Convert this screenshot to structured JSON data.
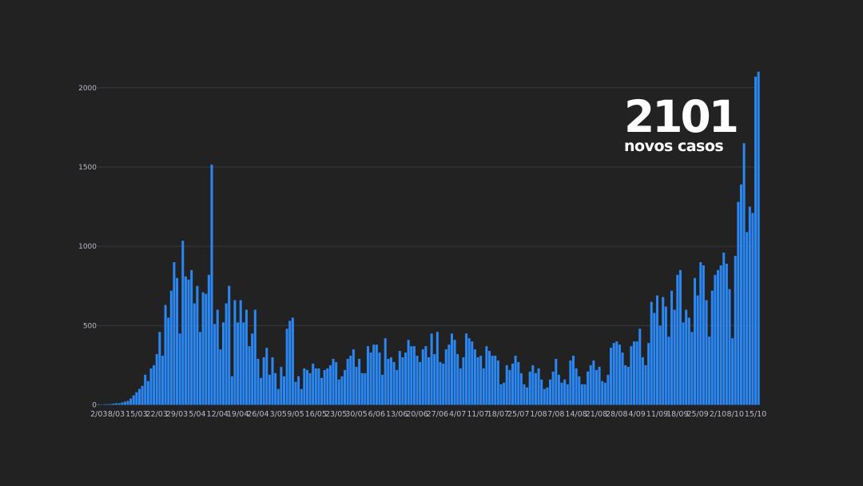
{
  "callout": {
    "number": "2101",
    "label": "novos casos"
  },
  "colors": {
    "background": "#222223",
    "bar": "#2b87f2",
    "grid": "#3a3a3c",
    "tick_label": "#b9bccb"
  },
  "chart_data": {
    "type": "bar",
    "title": "",
    "xlabel": "",
    "ylabel": "",
    "ylim": [
      0,
      2150
    ],
    "yticks": [
      0,
      500,
      1000,
      1500,
      2000
    ],
    "grid": true,
    "legend": "none",
    "x_tick_labels": [
      "2/03",
      "8/03",
      "15/03",
      "22/03",
      "29/03",
      "5/04",
      "12/04",
      "19/04",
      "26/04",
      "3/05",
      "9/05",
      "16/05",
      "23/05",
      "30/05",
      "6/06",
      "13/06",
      "20/06",
      "27/06",
      "4/07",
      "11/07",
      "18/07",
      "25/07",
      "1/08",
      "7/08",
      "14/08",
      "21/08",
      "28/08",
      "4/09",
      "11/09",
      "18/09",
      "25/09",
      "2/10",
      "8/10",
      "15/10"
    ],
    "categories": [
      "2/03",
      "3/03",
      "4/03",
      "5/03",
      "6/03",
      "7/03",
      "8/03",
      "9/03",
      "10/03",
      "11/03",
      "12/03",
      "13/03",
      "14/03",
      "15/03",
      "16/03",
      "17/03",
      "18/03",
      "19/03",
      "20/03",
      "21/03",
      "22/03",
      "23/03",
      "24/03",
      "25/03",
      "26/03",
      "27/03",
      "28/03",
      "29/03",
      "30/03",
      "31/03",
      "1/04",
      "2/04",
      "3/04",
      "4/04",
      "5/04",
      "6/04",
      "7/04",
      "8/04",
      "9/04",
      "10/04",
      "11/04",
      "12/04",
      "13/04",
      "14/04",
      "15/04",
      "16/04",
      "17/04",
      "18/04",
      "19/04",
      "20/04",
      "21/04",
      "22/04",
      "23/04",
      "24/04",
      "25/04",
      "26/04",
      "27/04",
      "28/04",
      "29/04",
      "30/04",
      "1/05",
      "2/05",
      "3/05",
      "4/05",
      "5/05",
      "6/05",
      "7/05",
      "8/05",
      "9/05",
      "10/05",
      "11/05",
      "12/05",
      "13/05",
      "14/05",
      "15/05",
      "16/05",
      "17/05",
      "18/05",
      "19/05",
      "20/05",
      "21/05",
      "22/05",
      "23/05",
      "24/05",
      "25/05",
      "26/05",
      "27/05",
      "28/05",
      "29/05",
      "30/05",
      "31/05",
      "1/06",
      "2/06",
      "3/06",
      "4/06",
      "5/06",
      "6/06",
      "7/06",
      "8/06",
      "9/06",
      "10/06",
      "11/06",
      "12/06",
      "13/06",
      "14/06",
      "15/06",
      "16/06",
      "17/06",
      "18/06",
      "19/06",
      "20/06",
      "21/06",
      "22/06",
      "23/06",
      "24/06",
      "25/06",
      "26/06",
      "27/06",
      "28/06",
      "29/06",
      "30/06",
      "1/07",
      "2/07",
      "3/07",
      "4/07",
      "5/07",
      "6/07",
      "7/07",
      "8/07",
      "9/07",
      "10/07",
      "11/07",
      "12/07",
      "13/07",
      "14/07",
      "15/07",
      "16/07",
      "17/07",
      "18/07",
      "19/07",
      "20/07",
      "21/07",
      "22/07",
      "23/07",
      "24/07",
      "25/07",
      "26/07",
      "27/07",
      "28/07",
      "29/07",
      "30/07",
      "31/07",
      "1/08",
      "2/08",
      "3/08",
      "4/08",
      "5/08",
      "6/08",
      "7/08",
      "8/08",
      "9/08",
      "10/08",
      "11/08",
      "12/08",
      "13/08",
      "14/08",
      "15/08",
      "16/08",
      "17/08",
      "18/08",
      "19/08",
      "20/08",
      "21/08",
      "22/08",
      "23/08",
      "24/08",
      "25/08",
      "26/08",
      "27/08",
      "28/08",
      "29/08",
      "30/08",
      "31/08",
      "1/09",
      "2/09",
      "3/09",
      "4/09",
      "5/09",
      "6/09",
      "7/09",
      "8/09",
      "9/09",
      "10/09",
      "11/09",
      "12/09",
      "13/09",
      "14/09",
      "15/09",
      "16/09",
      "17/09",
      "18/09",
      "19/09",
      "20/09",
      "21/09",
      "22/09",
      "23/09",
      "24/09",
      "25/09",
      "26/09",
      "27/09",
      "28/09",
      "29/09",
      "30/09",
      "1/10",
      "2/10",
      "3/10",
      "4/10",
      "5/10",
      "6/10",
      "7/10",
      "8/10",
      "9/10",
      "10/10",
      "11/10",
      "12/10",
      "13/10",
      "14/10",
      "15/10"
    ],
    "values": [
      2,
      0,
      2,
      3,
      5,
      8,
      10,
      10,
      15,
      20,
      25,
      40,
      60,
      80,
      100,
      120,
      190,
      150,
      230,
      250,
      320,
      460,
      310,
      630,
      550,
      720,
      900,
      800,
      450,
      1035,
      810,
      790,
      850,
      640,
      750,
      460,
      710,
      700,
      820,
      1515,
      510,
      600,
      350,
      520,
      640,
      750,
      180,
      660,
      520,
      660,
      520,
      600,
      370,
      450,
      600,
      290,
      170,
      300,
      360,
      190,
      300,
      200,
      100,
      240,
      180,
      480,
      530,
      550,
      145,
      180,
      100,
      230,
      220,
      200,
      260,
      230,
      230,
      170,
      220,
      230,
      250,
      290,
      270,
      160,
      180,
      220,
      290,
      310,
      350,
      240,
      290,
      200,
      200,
      370,
      330,
      380,
      380,
      330,
      190,
      420,
      290,
      300,
      270,
      220,
      340,
      300,
      330,
      410,
      370,
      370,
      310,
      270,
      350,
      370,
      300,
      450,
      320,
      460,
      270,
      260,
      350,
      380,
      450,
      410,
      320,
      230,
      300,
      450,
      420,
      400,
      350,
      300,
      310,
      230,
      370,
      340,
      310,
      310,
      280,
      130,
      140,
      250,
      220,
      260,
      310,
      270,
      200,
      130,
      110,
      210,
      250,
      200,
      230,
      160,
      100,
      110,
      160,
      210,
      290,
      190,
      140,
      160,
      130,
      280,
      310,
      230,
      180,
      130,
      130,
      210,
      250,
      280,
      220,
      240,
      150,
      140,
      190,
      360,
      390,
      400,
      380,
      330,
      250,
      240,
      370,
      400,
      400,
      480,
      300,
      250,
      390,
      650,
      580,
      690,
      500,
      680,
      620,
      430,
      720,
      600,
      820,
      850,
      520,
      600,
      550,
      460,
      800,
      690,
      900,
      880,
      660,
      430,
      720,
      820,
      850,
      880,
      960,
      890,
      730,
      420,
      940,
      1280,
      1390,
      1650,
      1090,
      1250,
      1210,
      2070,
      2101
    ]
  }
}
